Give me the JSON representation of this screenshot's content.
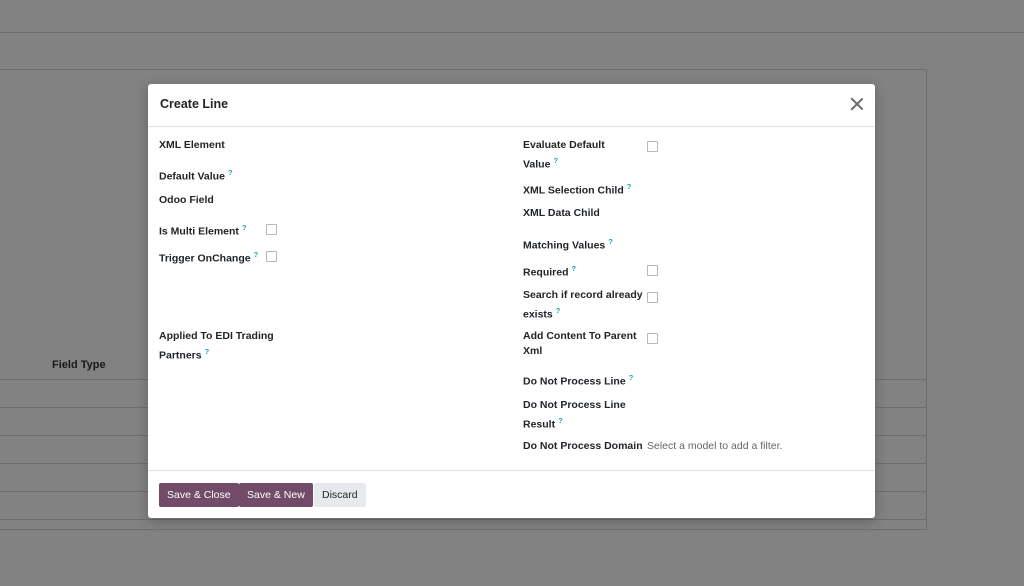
{
  "background": {
    "table_header": {
      "field_type": "Field Type"
    }
  },
  "modal": {
    "title": "Create Line",
    "help_glyph": "?",
    "left_fields": {
      "xml_element": "XML Element",
      "default_value": "Default Value",
      "odoo_field": "Odoo Field",
      "is_multi_element": "Is Multi Element",
      "trigger_onchange": "Trigger OnChange",
      "applied_to_partners_line1": "Applied To EDI Trading",
      "applied_to_partners_line2": "Partners"
    },
    "right_fields": {
      "evaluate_default_line1": "Evaluate Default",
      "evaluate_default_line2": "Value",
      "xml_selection_child": "XML Selection Child",
      "xml_data_child": "XML Data Child",
      "matching_values": "Matching Values",
      "required": "Required",
      "search_record_line1": "Search if record already",
      "search_record_line2": "exists",
      "add_content_line1": "Add Content To Parent",
      "add_content_line2": "Xml",
      "do_not_process_line": "Do Not Process Line",
      "do_not_process_result_line1": "Do Not Process Line",
      "do_not_process_result_line2": "Result",
      "do_not_process_domain": "Do Not Process Domain",
      "domain_placeholder": "Select a model to add a filter."
    },
    "checkboxes": {
      "is_multi_element": false,
      "trigger_onchange": false,
      "evaluate_default_value": false,
      "required": false,
      "search_if_record_exists": false,
      "add_content_to_parent_xml": false
    },
    "footer": {
      "save_close": "Save & Close",
      "save_new": "Save & New",
      "discard": "Discard"
    }
  },
  "colors": {
    "primary": "#714b67",
    "help": "#17a2b8",
    "backdrop": "rgba(0,0,0,0.49)"
  }
}
